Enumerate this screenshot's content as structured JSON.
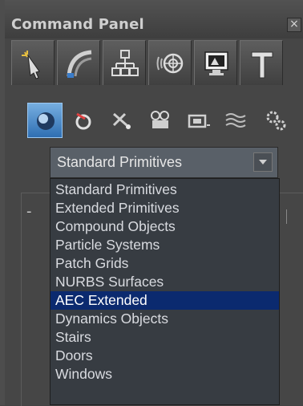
{
  "window": {
    "title": "Command Panel",
    "close_glyph": "×"
  },
  "tabs": [
    {
      "name": "create",
      "icon": "cursor-star-icon"
    },
    {
      "name": "modify",
      "icon": "modify-arc-icon"
    },
    {
      "name": "hierarchy",
      "icon": "hierarchy-icon"
    },
    {
      "name": "motion",
      "icon": "motion-icon"
    },
    {
      "name": "display",
      "icon": "display-icon"
    },
    {
      "name": "utilities",
      "icon": "hammer-icon"
    }
  ],
  "categories": [
    {
      "name": "geometry",
      "icon": "sphere-icon",
      "active": true
    },
    {
      "name": "shapes",
      "icon": "shapes-icon",
      "active": false
    },
    {
      "name": "lights",
      "icon": "light-icon",
      "active": false
    },
    {
      "name": "cameras",
      "icon": "camera-icon",
      "active": false
    },
    {
      "name": "helpers",
      "icon": "helper-icon",
      "active": false
    },
    {
      "name": "spacewarps",
      "icon": "spacewarp-icon",
      "active": false
    },
    {
      "name": "systems",
      "icon": "gears-icon",
      "active": false
    }
  ],
  "dropdown": {
    "selected_label": "Standard Primitives",
    "options": [
      "Standard Primitives",
      "Extended Primitives",
      "Compound Objects",
      "Particle Systems",
      "Patch Grids",
      "NURBS Surfaces",
      "AEC Extended",
      "Dynamics Objects",
      "Stairs",
      "Doors",
      "Windows"
    ],
    "highlighted_option": "AEC Extended"
  },
  "rollout": {
    "collapse_glyph": "-"
  },
  "colors": {
    "panel_bg": "#464646",
    "list_bg": "#373c42",
    "highlight": "#0b2a6f",
    "active_icon_bg": "#2f6fb3"
  }
}
